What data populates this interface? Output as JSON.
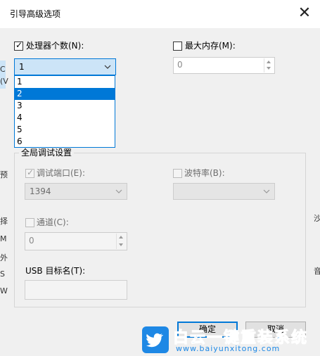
{
  "dialog": {
    "title": "引导高级选项",
    "close_glyph": "✕"
  },
  "processor": {
    "label": "处理器个数(N):",
    "checked": true,
    "selected_value": "1",
    "dropdown_open": true,
    "options": [
      "1",
      "2",
      "3",
      "4",
      "5",
      "6"
    ],
    "highlighted_option": "2"
  },
  "max_memory": {
    "label": "最大内存(M):",
    "checked": false,
    "value": "0"
  },
  "global_debug": {
    "group_title": "全局调试设置",
    "debug_port": {
      "label": "调试端口(E):",
      "checked": true,
      "value": "1394"
    },
    "baud_rate": {
      "label": "波特率(B):",
      "checked": false,
      "value": ""
    },
    "channel": {
      "label": "通道(C):",
      "checked": false,
      "value": "0"
    },
    "usb_target": {
      "label": "USB 目标名(T):",
      "value": ""
    }
  },
  "buttons": {
    "ok": "确定",
    "cancel": "取消"
  },
  "background_fragments": {
    "left": [
      "C",
      "(V",
      "预",
      "择",
      "M",
      "外",
      "S",
      "W"
    ],
    "right": [
      "沙",
      "音"
    ]
  },
  "watermark": {
    "title": "白云一键重装系统",
    "url": "www.baiyunxitong.com",
    "logo_icon": "twitter-bird-icon",
    "color": "#1e88e5"
  },
  "colors": {
    "accent": "#0078d7",
    "dialog_bg": "#f0f0f0"
  }
}
